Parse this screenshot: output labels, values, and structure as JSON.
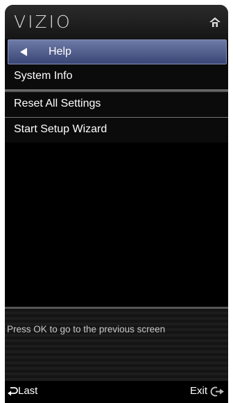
{
  "header": {
    "logo": "VIZIO",
    "home_icon": "home-icon"
  },
  "nav": {
    "back_icon": "back-arrow-icon",
    "title": "Help"
  },
  "menu": {
    "items": [
      {
        "label": "System Info"
      },
      {
        "label": "Reset All Settings"
      },
      {
        "label": "Start Setup Wizard"
      }
    ]
  },
  "hint": "Press OK  to go to the previous screen",
  "footer": {
    "last_label": "Last",
    "last_icon": "return-arrow-icon",
    "exit_label": "Exit",
    "exit_icon": "exit-icon"
  },
  "colors": {
    "nav_bar": "#4d5a8a",
    "background": "#000000",
    "text": "#ffffff"
  }
}
